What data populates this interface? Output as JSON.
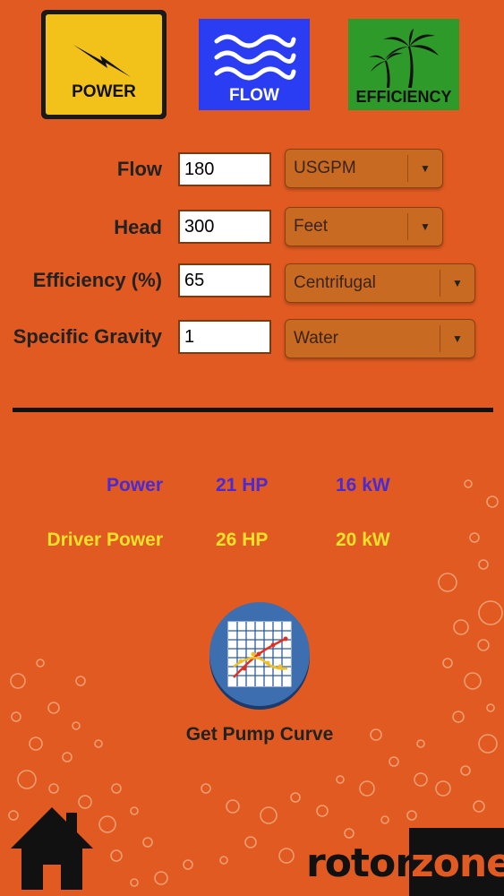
{
  "tabs": {
    "power": {
      "label": "POWER",
      "icon": "lightning-bolt-icon",
      "color": "#f2c21a"
    },
    "flow": {
      "label": "FLOW",
      "icon": "water-waves-icon",
      "color": "#2a3df2"
    },
    "efficiency": {
      "label": "EFFICIENCY",
      "icon": "palm-trees-icon",
      "color": "#2e9a2a"
    }
  },
  "form": {
    "flow": {
      "label": "Flow",
      "value": "180",
      "unit": "USGPM"
    },
    "head": {
      "label": "Head",
      "value": "300",
      "unit": "Feet"
    },
    "efficiency": {
      "label": "Efficiency (%)",
      "value": "65",
      "unit": "Centrifugal"
    },
    "specific_gravity": {
      "label": "Specific Gravity",
      "value": "1",
      "unit": "Water"
    }
  },
  "results": {
    "power": {
      "label": "Power",
      "hp": "21 HP",
      "kw": "16 kW",
      "color": "#4a2ad2"
    },
    "driver_power": {
      "label": "Driver Power",
      "hp": "26 HP",
      "kw": "20 kW",
      "color": "#f5e02a"
    }
  },
  "actions": {
    "pump_curve_label": "Get Pump Curve"
  },
  "brand": {
    "part1": "rotor",
    "part2": "zone"
  },
  "colors": {
    "background": "#e05a22"
  }
}
